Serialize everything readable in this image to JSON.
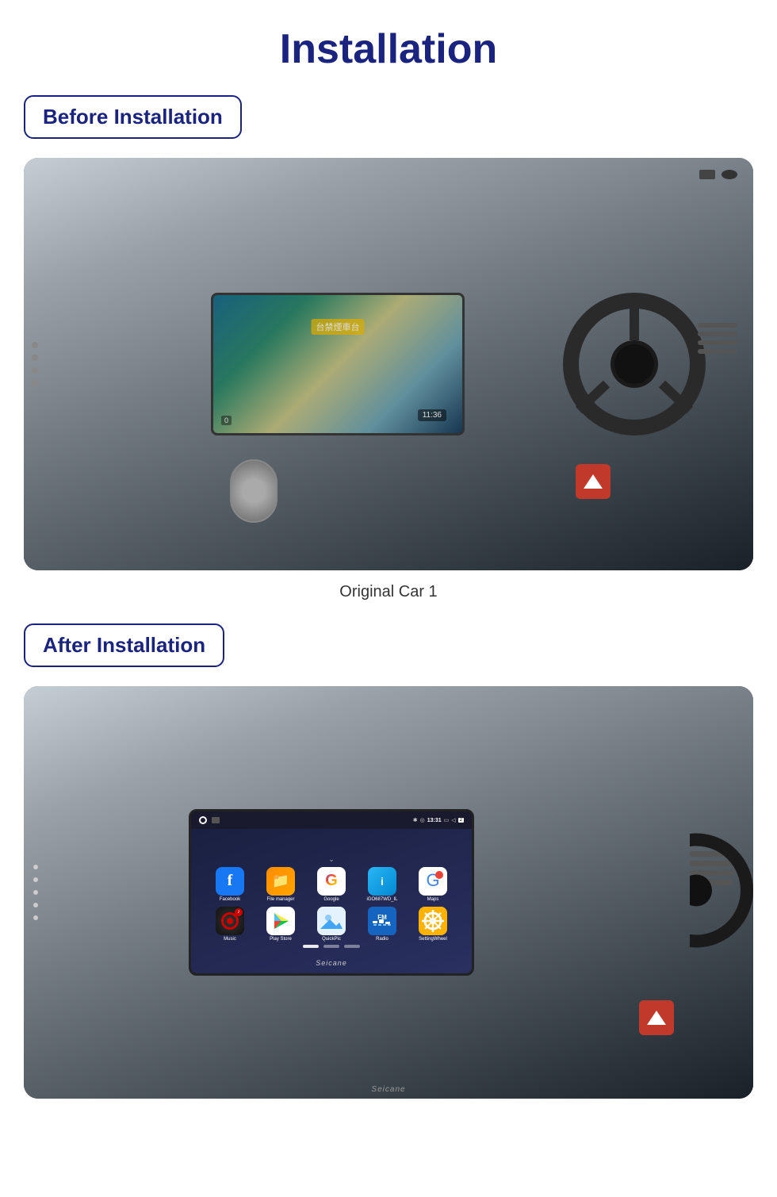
{
  "page": {
    "title": "Installation",
    "before_section": {
      "label": "Before Installation",
      "caption": "Original Car  1"
    },
    "after_section": {
      "label": "After Installation",
      "watermark": "Seicane",
      "apps": [
        {
          "name": "Facebook",
          "icon": "facebook-icon",
          "row": 1
        },
        {
          "name": "File manager",
          "icon": "file-manager-icon",
          "row": 1
        },
        {
          "name": "Google",
          "icon": "google-icon",
          "row": 1
        },
        {
          "name": "iGO687WD_IL",
          "icon": "igo-icon",
          "row": 1
        },
        {
          "name": "Maps",
          "icon": "maps-icon",
          "row": 1
        },
        {
          "name": "Music",
          "icon": "music-icon",
          "row": 2
        },
        {
          "name": "Play Store",
          "icon": "play-store-icon",
          "row": 2
        },
        {
          "name": "QuickPic",
          "icon": "quickpic-icon",
          "row": 2
        },
        {
          "name": "Radio",
          "icon": "radio-icon",
          "row": 2
        },
        {
          "name": "SettingWheel",
          "icon": "setting-wheel-icon",
          "row": 2
        }
      ],
      "statusbar": {
        "time": "13:31"
      }
    }
  }
}
